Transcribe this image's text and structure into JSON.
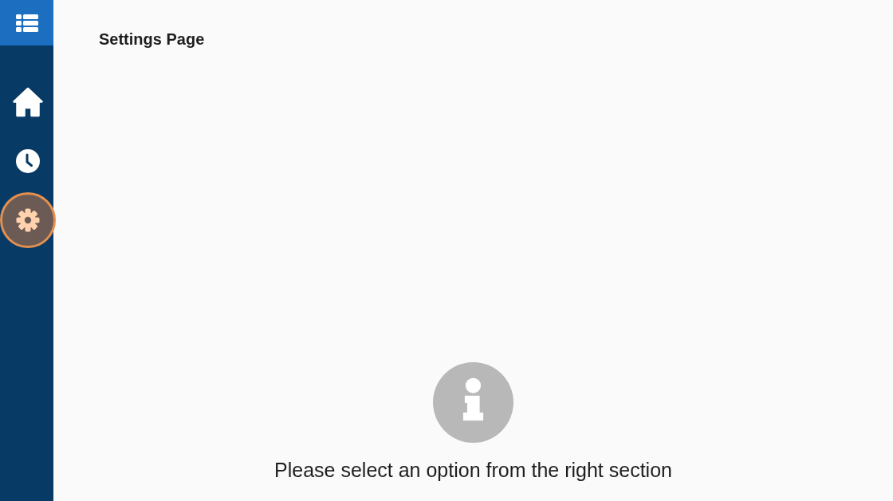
{
  "sidebar": {
    "items": [
      {
        "kind": "home",
        "selected": false
      },
      {
        "kind": "clock",
        "selected": false
      },
      {
        "kind": "settings",
        "selected": true
      }
    ]
  },
  "page": {
    "title": "Settings Page"
  },
  "empty_state": {
    "message": "Please select an option from the right section"
  }
}
